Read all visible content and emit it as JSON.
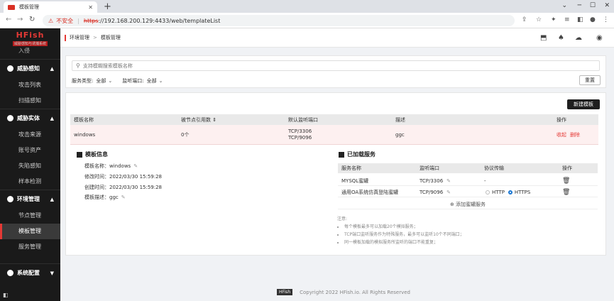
{
  "browser": {
    "tab_title": "模板管理",
    "security_label": "不安全",
    "url_scheme": "https",
    "url_rest": "://192.168.200.129:4433/web/templateList"
  },
  "sidebar": {
    "brand": "HFish",
    "subtitle": "威胁感知与诱捕系统",
    "top_item": "入侵",
    "groups": [
      {
        "label": "威胁感知",
        "items": [
          "攻击列表",
          "扫描感知"
        ]
      },
      {
        "label": "威胁实体",
        "items": [
          "攻击来源",
          "账号资产",
          "失陷感知",
          "样本检测"
        ]
      },
      {
        "label": "环境管理",
        "items": [
          "节点管理",
          "模板管理",
          "服务管理"
        ]
      },
      {
        "label": "系统配置",
        "items": []
      }
    ]
  },
  "header": {
    "crumb1": "环境管理",
    "crumb2": "模板管理"
  },
  "filter": {
    "search_placeholder": "支持模糊搜索模板名称",
    "service_type_label": "服务类型:",
    "service_type_value": "全部",
    "port_label": "监听端口:",
    "port_value": "全部",
    "reset_label": "重置"
  },
  "table": {
    "new_button": "新建模板",
    "headers": {
      "name": "模板名称",
      "ref": "被节点引用数 ⇕",
      "ports": "默认监听端口",
      "desc": "描述",
      "ops": "操作"
    },
    "row": {
      "name": "windows",
      "ref": "0个",
      "port1": "TCP/3306",
      "port2": "TCP/9096",
      "desc": "ggc",
      "collapse": "收起",
      "delete": "删除"
    }
  },
  "detail": {
    "info_title": "模板信息",
    "name_label": "模板名称：",
    "name_value": "windows",
    "modified_label": "修改时间：",
    "modified_value": "2022/03/30 15:59:28",
    "created_label": "创建时间：",
    "created_value": "2022/03/30 15:59:28",
    "desc_label": "模板描述：",
    "desc_value": "ggc",
    "services_title": "已加载服务",
    "svc_headers": {
      "name": "服务名称",
      "port": "监听端口",
      "proto": "协议传输",
      "ops": "操作"
    },
    "services": [
      {
        "name": "MYSQL蜜罐",
        "port": "TCP/3306",
        "proto": "-"
      },
      {
        "name": "通用OA系统仿真登陆蜜罐",
        "port": "TCP/9096",
        "http": "HTTP",
        "https": "HTTPS"
      }
    ],
    "add_service": "添加蜜罐服务",
    "notes_title": "注意:",
    "notes": [
      "每个模板最多可以加载20个模拟服务；",
      "TCP端口监听服务作为特殊服务，最多可以监听10个不同端口；",
      "同一模板加载的模拟服务所监听的端口不能重复；"
    ]
  },
  "footer": {
    "logo": "HFish",
    "copyright": "Copyright 2022 HFish.io. All Rights Reserved"
  }
}
